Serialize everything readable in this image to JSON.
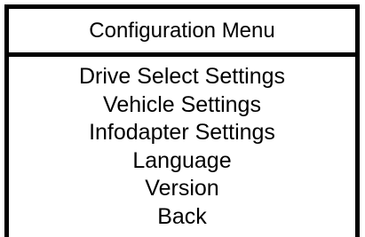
{
  "menu": {
    "title": "Configuration Menu",
    "items": [
      {
        "label": "Drive Select Settings"
      },
      {
        "label": "Vehicle Settings"
      },
      {
        "label": "Infodapter Settings"
      },
      {
        "label": "Language"
      },
      {
        "label": "Version"
      },
      {
        "label": "Back"
      }
    ]
  }
}
